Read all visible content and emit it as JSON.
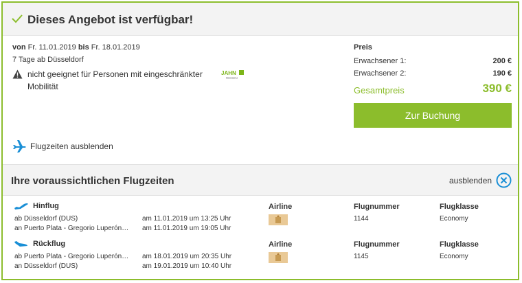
{
  "header": {
    "title": "Dieses Angebot ist verfügbar!"
  },
  "offer": {
    "from_label": "von",
    "from_date": "Fr. 11.01.2019",
    "to_label": "bis",
    "to_date": "Fr. 18.01.2019",
    "duration": "7 Tage ab Düsseldorf",
    "mobility_warning": "nicht geeignet für Personen mit eingeschränkter Mobilität",
    "logo_text": "JAHN",
    "logo_sub": "REISEN"
  },
  "price": {
    "title": "Preis",
    "rows": [
      {
        "label": "Erwachsener 1:",
        "value": "200 €"
      },
      {
        "label": "Erwachsener 2:",
        "value": "190 €"
      }
    ],
    "total_label": "Gesamtpreis",
    "total_value": "390 €",
    "book_button": "Zur Buchung"
  },
  "toggle_flights_label": "Flugzeiten ausblenden",
  "flights_section": {
    "title": "Ihre voraussichtlichen Flugzeiten",
    "hide_label": "ausblenden",
    "col_airline": "Airline",
    "col_flight_number": "Flugnummer",
    "col_class": "Flugklasse",
    "outbound": {
      "label": "Hinflug",
      "departure_place": "ab Düsseldorf (DUS)",
      "departure_time": "am 11.01.2019 um 13:25 Uhr",
      "arrival_place": "an Puerto Plata - Gregorio Luperón…",
      "arrival_time": "am 11.01.2019 um 19:05 Uhr",
      "flight_number": "1144",
      "class": "Economy"
    },
    "return": {
      "label": "Rückflug",
      "departure_place": "ab Puerto Plata - Gregorio Luperón…",
      "departure_time": "am 18.01.2019 um 20:35 Uhr",
      "arrival_place": "an Düsseldorf (DUS)",
      "arrival_time": "am 19.01.2019 um 10:40 Uhr",
      "flight_number": "1145",
      "class": "Economy"
    }
  },
  "colors": {
    "accent": "#8cbd2c",
    "plane_blue": "#1a8fd6"
  },
  "icons": [
    "check-icon",
    "warning-icon",
    "plane-icon",
    "close-circle-icon",
    "airplane-takeoff-icon",
    "airplane-landing-icon",
    "airline-logo-icon"
  ]
}
